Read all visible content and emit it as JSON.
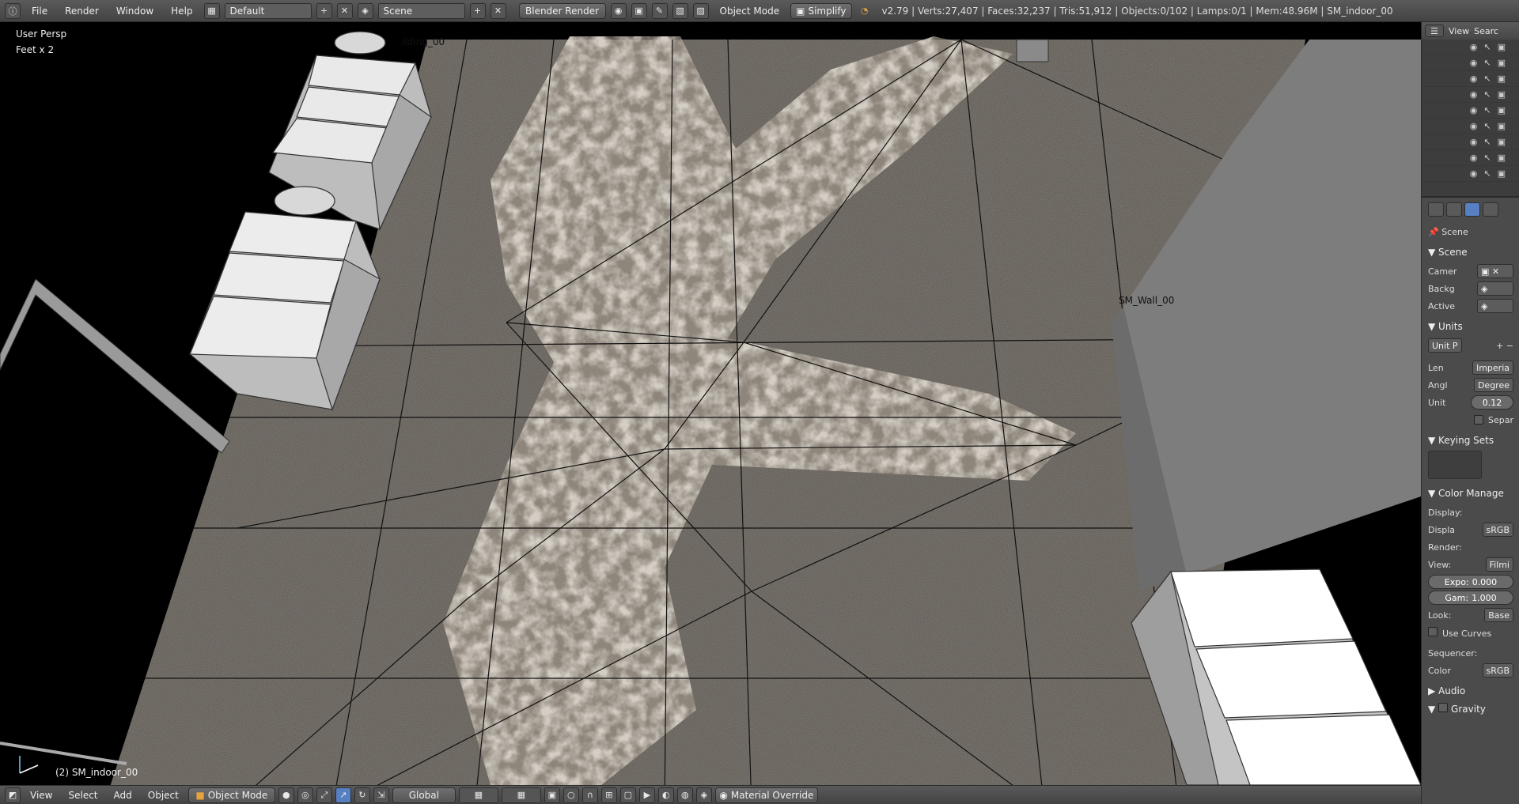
{
  "menu": [
    "File",
    "Render",
    "Window",
    "Help"
  ],
  "layout": {
    "name": "Default"
  },
  "scene": {
    "name": "Scene"
  },
  "renderer": "Blender Render",
  "mode": "Object Mode",
  "simplify": "Simplify",
  "stats": "v2.79 | Verts:27,407 | Faces:32,237 | Tris:51,912 | Objects:0/102 | Lamps:0/1 | Mem:48.96M | SM_indoor_00",
  "viewport": {
    "view_label": "User Persp",
    "unit_label": "Feet x 2",
    "object_labels": [
      "ilding_00",
      "SM_Wall_00"
    ],
    "active_object": "(2) SM_indoor_00"
  },
  "bottom": {
    "menus": [
      "View",
      "Select",
      "Add",
      "Object"
    ],
    "mode": "Object Mode",
    "orientation": "Global",
    "material_override": "Material Override"
  },
  "outliner": {
    "view": "View",
    "search": "Searc",
    "rows": 9
  },
  "properties": {
    "context": "Scene",
    "scene_section": "Scene",
    "camera_label": "Camer",
    "background_label": "Backg",
    "active_label": "Active",
    "units_section": "Units",
    "unit_preset": "Unit P",
    "length_label": "Len",
    "length_value": "Imperia",
    "angle_label": "Angl",
    "angle_value": "Degree",
    "unit_scale_label": "Unit",
    "unit_scale_value": "0.12",
    "separate": "Separ",
    "keying_section": "Keying Sets",
    "color_section": "Color Manage",
    "display_label": "Display:",
    "display_device_label": "Displa",
    "display_device": "sRGB",
    "render_label": "Render:",
    "view_label": "View:",
    "view_value": "Filmi",
    "exposure_label": "Expo:",
    "exposure": "0.000",
    "gamma_label": "Gam:",
    "gamma": "1.000",
    "look_label": "Look:",
    "look_value": "Base",
    "use_curves": "Use Curves",
    "sequencer_label": "Sequencer:",
    "color_label": "Color",
    "color_value": "sRGB",
    "audio_section": "Audio",
    "gravity_section": "Gravity"
  },
  "colors": {
    "floor": "#5b5650",
    "carpet": "#a79d8e",
    "wall": "#7d7d7d",
    "accent": "#5680c2"
  }
}
